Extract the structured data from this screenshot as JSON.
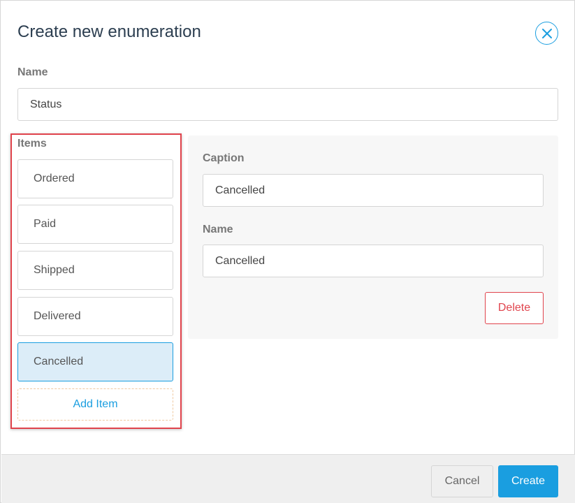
{
  "dialog": {
    "title": "Create new enumeration",
    "close_icon": "close-circle-icon"
  },
  "name_field": {
    "label": "Name",
    "value": "Status"
  },
  "items": {
    "label": "Items",
    "list": [
      {
        "label": "Ordered",
        "selected": false
      },
      {
        "label": "Paid",
        "selected": false
      },
      {
        "label": "Shipped",
        "selected": false
      },
      {
        "label": "Delivered",
        "selected": false
      },
      {
        "label": "Cancelled",
        "selected": true
      }
    ],
    "add_label": "Add Item"
  },
  "details": {
    "caption_label": "Caption",
    "caption_value": "Cancelled",
    "name_label": "Name",
    "name_value": "Cancelled",
    "delete_label": "Delete"
  },
  "footer": {
    "cancel_label": "Cancel",
    "create_label": "Create"
  },
  "colors": {
    "accent": "#1a9ee0",
    "danger": "#e0434c",
    "selected_bg": "#dcedf8"
  }
}
